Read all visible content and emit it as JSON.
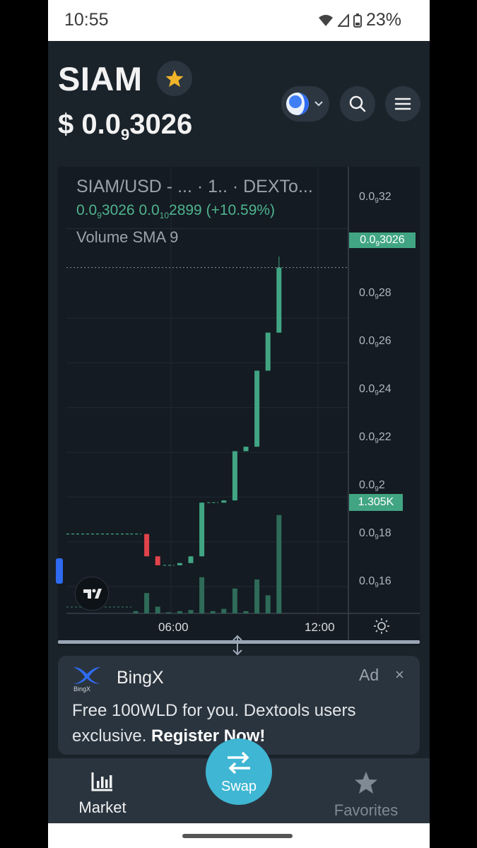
{
  "status_bar": {
    "time": "10:55",
    "battery": "23%"
  },
  "header": {
    "token_symbol": "SIAM",
    "price_prefix": "$ 0.0",
    "price_zeros": "9",
    "price_digits": "3026"
  },
  "chart": {
    "title": "SIAM/USD - ... · 1.. · DEXTo...",
    "ohlc_open_prefix": "0.0",
    "ohlc_open_zeros": "9",
    "ohlc_open_digits": "3026",
    "ohlc_prev_prefix": "0.0",
    "ohlc_prev_zeros": "10",
    "ohlc_prev_digits": "2899",
    "ohlc_change": "(+10.59%)",
    "volume_label": "Volume SMA 9",
    "y_ticks": [
      {
        "prefix": "0.0",
        "zeros": "9",
        "digits": "32"
      },
      {
        "prefix": "0.0",
        "zeros": "9",
        "digits": "28"
      },
      {
        "prefix": "0.0",
        "zeros": "9",
        "digits": "26"
      },
      {
        "prefix": "0.0",
        "zeros": "9",
        "digits": "24"
      },
      {
        "prefix": "0.0",
        "zeros": "9",
        "digits": "22"
      },
      {
        "prefix": "0.0",
        "zeros": "9",
        "digits": "2"
      },
      {
        "prefix": "0.0",
        "zeros": "9",
        "digits": "18"
      },
      {
        "prefix": "0.0",
        "zeros": "9",
        "digits": "16"
      }
    ],
    "price_tag": {
      "prefix": "0.0",
      "zeros": "9",
      "digits": "3026"
    },
    "volume_tag": "1.305K",
    "x_ticks": [
      "06:00",
      "12:00"
    ],
    "colors": {
      "up": "#41a583",
      "down": "#e0434b",
      "volume": "#2e6b58"
    }
  },
  "chart_data": {
    "type": "candlestick",
    "title": "SIAM/USD - ... · 1.. · DEXTo...",
    "y_unit": "price in units of 1e-10 USD",
    "ylim": [
      0.148,
      0.335
    ],
    "x_ticks": [
      "06:00",
      "12:00"
    ],
    "candles": [
      {
        "open": 0.1835,
        "close": 0.1835,
        "high": 0.1835,
        "low": 0.1835
      },
      {
        "open": 0.1835,
        "close": 0.1735,
        "high": 0.1835,
        "low": 0.1735
      },
      {
        "open": 0.1735,
        "close": 0.1695,
        "high": 0.1735,
        "low": 0.1695
      },
      {
        "open": 0.1695,
        "close": 0.1695,
        "high": 0.1695,
        "low": 0.1695
      },
      {
        "open": 0.1695,
        "close": 0.1705,
        "high": 0.1705,
        "low": 0.1695
      },
      {
        "open": 0.1705,
        "close": 0.1735,
        "high": 0.1735,
        "low": 0.1705
      },
      {
        "open": 0.1735,
        "close": 0.1975,
        "high": 0.1975,
        "low": 0.1735
      },
      {
        "open": 0.1975,
        "close": 0.1975,
        "high": 0.1975,
        "low": 0.1975
      },
      {
        "open": 0.1975,
        "close": 0.1985,
        "high": 0.1985,
        "low": 0.1975
      },
      {
        "open": 0.1985,
        "close": 0.2205,
        "high": 0.2205,
        "low": 0.1985
      },
      {
        "open": 0.2205,
        "close": 0.2225,
        "high": 0.2225,
        "low": 0.2205
      },
      {
        "open": 0.2225,
        "close": 0.2565,
        "high": 0.2565,
        "low": 0.2225
      },
      {
        "open": 0.2565,
        "close": 0.2735,
        "high": 0.2735,
        "low": 0.2565
      },
      {
        "open": 0.2735,
        "close": 0.3026,
        "high": 0.3075,
        "low": 0.2735
      }
    ],
    "volume_sma": 1305
  },
  "ad": {
    "brand": "BingX",
    "label": "Ad",
    "close": "×",
    "text": "Free 100WLD for you. Dextools users exclusive.",
    "cta": "Register Now!"
  },
  "nav": {
    "market_label": "Market",
    "swap_label": "Swap",
    "favorites_label": "Favorites"
  }
}
